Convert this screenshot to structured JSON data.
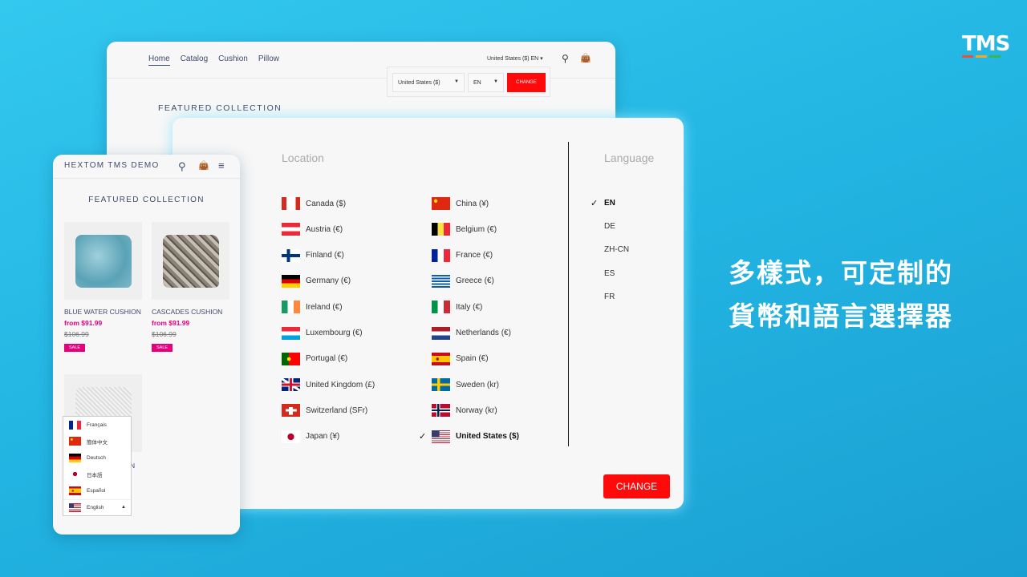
{
  "brand": {
    "logo_text": "TMS",
    "logo_bar_colors": [
      "#f04e37",
      "#f5a623",
      "#3cb54a"
    ]
  },
  "headline": {
    "line1": "多樣式，可定制的",
    "line2": "貨幣和語言選擇器"
  },
  "desktop": {
    "nav": [
      "Home",
      "Catalog",
      "Cushion",
      "Pillow"
    ],
    "currency_toggle": "United States ($) EN",
    "country_select": "United States ($)",
    "language_select": "EN",
    "change_label": "CHANGE",
    "featured": "FEATURED COLLECTION"
  },
  "modal": {
    "location_header": "Location",
    "language_header": "Language",
    "countries": [
      {
        "label": "Canada ($)",
        "flag": "ca"
      },
      {
        "label": "China (¥)",
        "flag": "cn"
      },
      {
        "label": "Austria (€)",
        "flag": "at"
      },
      {
        "label": "Belgium (€)",
        "flag": "be"
      },
      {
        "label": "Finland (€)",
        "flag": "fi"
      },
      {
        "label": "France (€)",
        "flag": "fr"
      },
      {
        "label": "Germany (€)",
        "flag": "de"
      },
      {
        "label": "Greece (€)",
        "flag": "gr"
      },
      {
        "label": "Ireland (€)",
        "flag": "ie"
      },
      {
        "label": "Italy (€)",
        "flag": "it"
      },
      {
        "label": "Luxembourg (€)",
        "flag": "lu"
      },
      {
        "label": "Netherlands (€)",
        "flag": "nl"
      },
      {
        "label": "Portugal (€)",
        "flag": "pt"
      },
      {
        "label": "Spain (€)",
        "flag": "es"
      },
      {
        "label": "United Kingdom (£)",
        "flag": "gb"
      },
      {
        "label": "Sweden (kr)",
        "flag": "se"
      },
      {
        "label": "Switzerland (SFr)",
        "flag": "ch"
      },
      {
        "label": "Norway (kr)",
        "flag": "no"
      },
      {
        "label": "Japan (¥)",
        "flag": "jp"
      },
      {
        "label": "United States ($)",
        "flag": "us",
        "selected": true
      }
    ],
    "languages": [
      {
        "label": "EN",
        "selected": true
      },
      {
        "label": "DE"
      },
      {
        "label": "ZH-CN"
      },
      {
        "label": "ES"
      },
      {
        "label": "FR"
      }
    ],
    "check": "✓",
    "change_label": "CHANGE"
  },
  "mobile": {
    "store_title": "HEXTOM TMS DEMO",
    "featured": "FEATURED COLLECTION",
    "products": [
      {
        "name": "BLUE WATER CUSHION",
        "price": "from $91.99",
        "old_price": "$106.99",
        "badge": "SALE"
      },
      {
        "name": "CASCADES CUSHION",
        "price": "from $91.99",
        "old_price": "$106.99",
        "badge": "SALE"
      }
    ],
    "third_product_name_partial": "N",
    "language_menu": [
      {
        "label": "Français",
        "flag": "fr"
      },
      {
        "label": "簡体中文",
        "flag": "cn"
      },
      {
        "label": "Deutsch",
        "flag": "de"
      },
      {
        "label": "日本語",
        "flag": "jp"
      },
      {
        "label": "Español",
        "flag": "es"
      },
      {
        "label": "English",
        "flag": "us",
        "selected": true
      }
    ]
  },
  "colors": {
    "accent_red": "#ff0a0a",
    "sale_pink": "#e6007e",
    "nav_text": "#3d4a6b"
  }
}
